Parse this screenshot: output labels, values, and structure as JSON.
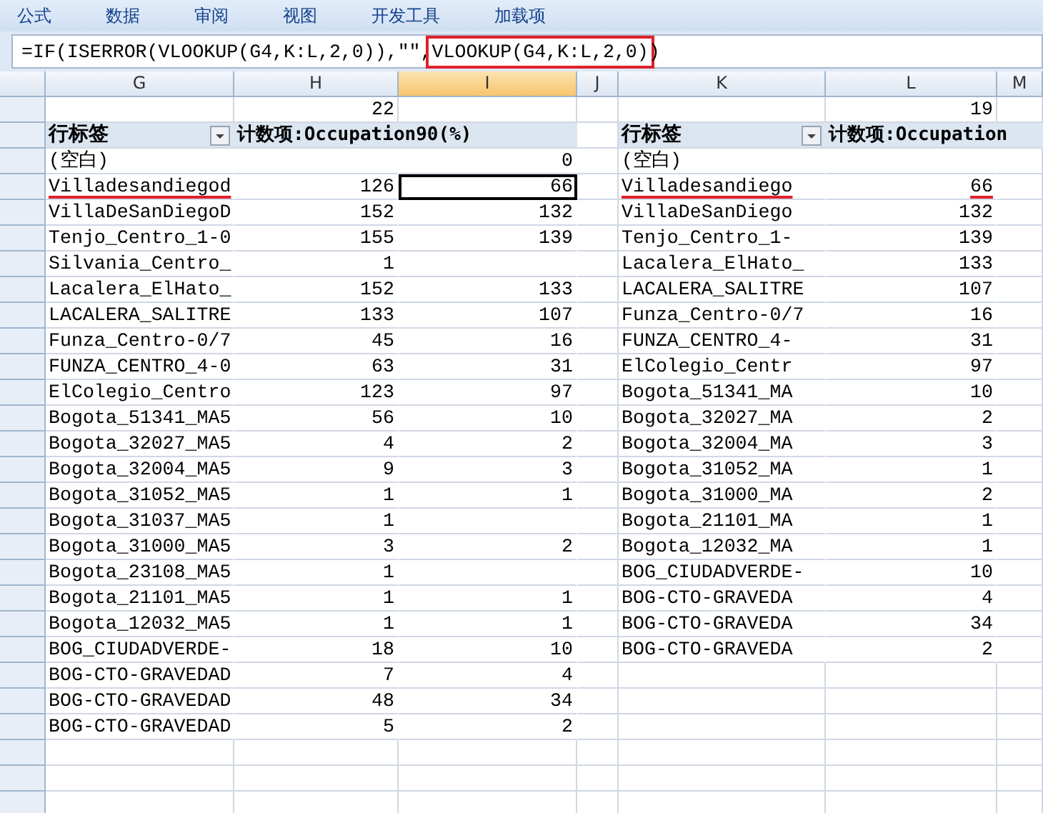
{
  "menu": [
    {
      "label": "公式"
    },
    {
      "label": "数据"
    },
    {
      "label": "审阅"
    },
    {
      "label": "视图"
    },
    {
      "label": "开发工具"
    },
    {
      "label": "加载项"
    }
  ],
  "formula_bar": {
    "parts": [
      {
        "text": "=IF(ISERROR(VLOOKUP(G4,K:L,2,0)),\"\",",
        "highlighted": false
      },
      {
        "text": "VLOOKUP(G4,K:L,2,0)",
        "highlighted": true
      },
      {
        "text": ")",
        "highlighted": false
      }
    ]
  },
  "columns": [
    {
      "label": "G",
      "selected": false
    },
    {
      "label": "H",
      "selected": false
    },
    {
      "label": "I",
      "selected": true
    },
    {
      "label": "J",
      "selected": false
    },
    {
      "label": "K",
      "selected": false
    },
    {
      "label": "L",
      "selected": false
    },
    {
      "label": "M",
      "selected": false
    }
  ],
  "left_pivot": {
    "total": "22",
    "row_header": "行标签",
    "value_header": "计数项:Occupation90(%)",
    "rows": [
      {
        "label": "(空白)",
        "lookup": "0",
        "selected": false,
        "underlined": false
      },
      {
        "label": "Villadesandiegod",
        "count": "126",
        "lookup": "66",
        "selected": true,
        "underlined": true
      },
      {
        "label": "VillaDeSanDiegoD",
        "count": "152",
        "lookup": "132",
        "selected": false,
        "underlined": false
      },
      {
        "label": "Tenjo_Centro_1-0",
        "count": "155",
        "lookup": "139",
        "selected": false,
        "underlined": false
      },
      {
        "label": "Silvania_Centro_",
        "count": "1",
        "selected": false,
        "underlined": false
      },
      {
        "label": "Lacalera_ElHato_",
        "count": "152",
        "lookup": "133",
        "selected": false,
        "underlined": false
      },
      {
        "label": "LACALERA_SALITRE",
        "count": "133",
        "lookup": "107",
        "selected": false,
        "underlined": false
      },
      {
        "label": "Funza_Centro-0/7",
        "count": "45",
        "lookup": "16",
        "selected": false,
        "underlined": false
      },
      {
        "label": "FUNZA_CENTRO_4-0",
        "count": "63",
        "lookup": "31",
        "selected": false,
        "underlined": false
      },
      {
        "label": "ElColegio_Centro",
        "count": "123",
        "lookup": "97",
        "selected": false,
        "underlined": false
      },
      {
        "label": "Bogota_51341_MA5",
        "count": "56",
        "lookup": "10",
        "selected": false,
        "underlined": false
      },
      {
        "label": "Bogota_32027_MA5",
        "count": "4",
        "lookup": "2",
        "selected": false,
        "underlined": false
      },
      {
        "label": "Bogota_32004_MA5",
        "count": "9",
        "lookup": "3",
        "selected": false,
        "underlined": false
      },
      {
        "label": "Bogota_31052_MA5",
        "count": "1",
        "lookup": "1",
        "selected": false,
        "underlined": false
      },
      {
        "label": "Bogota_31037_MA5",
        "count": "1",
        "selected": false,
        "underlined": false
      },
      {
        "label": "Bogota_31000_MA5",
        "count": "3",
        "lookup": "2",
        "selected": false,
        "underlined": false
      },
      {
        "label": "Bogota_23108_MA5",
        "count": "1",
        "selected": false,
        "underlined": false
      },
      {
        "label": "Bogota_21101_MA5",
        "count": "1",
        "lookup": "1",
        "selected": false,
        "underlined": false
      },
      {
        "label": "Bogota_12032_MA5",
        "count": "1",
        "lookup": "1",
        "selected": false,
        "underlined": false
      },
      {
        "label": "BOG_CIUDADVERDE-",
        "count": "18",
        "lookup": "10",
        "selected": false,
        "underlined": false
      },
      {
        "label": "BOG-CTO-GRAVEDAD",
        "count": "7",
        "lookup": "4",
        "selected": false,
        "underlined": false
      },
      {
        "label": "BOG-CTO-GRAVEDAD",
        "count": "48",
        "lookup": "34",
        "selected": false,
        "underlined": false
      },
      {
        "label": "BOG-CTO-GRAVEDAD",
        "count": "5",
        "lookup": "2",
        "selected": false,
        "underlined": false
      }
    ]
  },
  "right_pivot": {
    "total": "19",
    "row_header": "行标签",
    "value_header": "计数项:Occupation",
    "rows": [
      {
        "label": "(空白)",
        "underlined": false
      },
      {
        "label": "Villadesandiego",
        "count": "66",
        "underlined": true
      },
      {
        "label": "VillaDeSanDiego",
        "count": "132",
        "underlined": false
      },
      {
        "label": "Tenjo_Centro_1-",
        "count": "139",
        "underlined": false
      },
      {
        "label": "Lacalera_ElHato_",
        "count": "133",
        "underlined": false
      },
      {
        "label": "LACALERA_SALITRE",
        "count": "107",
        "underlined": false
      },
      {
        "label": "Funza_Centro-0/7",
        "count": "16",
        "underlined": false
      },
      {
        "label": "FUNZA_CENTRO_4-",
        "count": "31",
        "underlined": false
      },
      {
        "label": "ElColegio_Centr",
        "count": "97",
        "underlined": false
      },
      {
        "label": "Bogota_51341_MA",
        "count": "10",
        "underlined": false
      },
      {
        "label": "Bogota_32027_MA",
        "count": "2",
        "underlined": false
      },
      {
        "label": "Bogota_32004_MA",
        "count": "3",
        "underlined": false
      },
      {
        "label": "Bogota_31052_MA",
        "count": "1",
        "underlined": false
      },
      {
        "label": "Bogota_31000_MA",
        "count": "2",
        "underlined": false
      },
      {
        "label": "Bogota_21101_MA",
        "count": "1",
        "underlined": false
      },
      {
        "label": "Bogota_12032_MA",
        "count": "1",
        "underlined": false
      },
      {
        "label": "BOG_CIUDADVERDE-",
        "count": "10",
        "underlined": false
      },
      {
        "label": "BOG-CTO-GRAVEDA",
        "count": "4",
        "underlined": false
      },
      {
        "label": "BOG-CTO-GRAVEDA",
        "count": "34",
        "underlined": false
      },
      {
        "label": "BOG-CTO-GRAVEDA",
        "count": "2",
        "underlined": false
      }
    ]
  }
}
